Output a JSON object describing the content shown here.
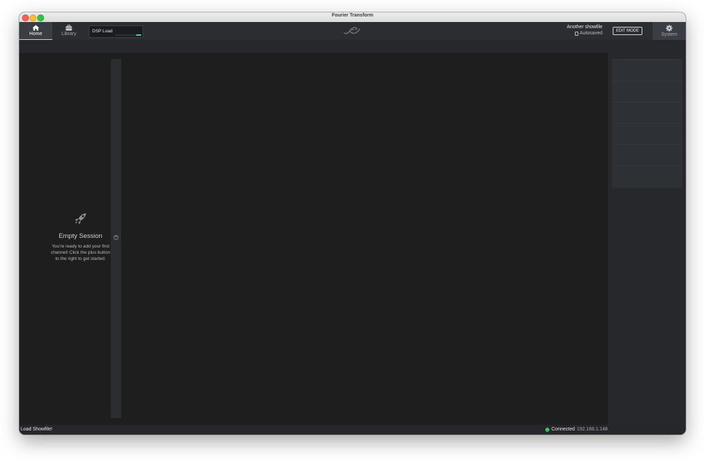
{
  "window": {
    "title": "Fourier Transform"
  },
  "nav": {
    "home": {
      "label": "Home",
      "icon": "home-icon"
    },
    "library": {
      "label": "Library",
      "icon": "briefcase-icon"
    },
    "system": {
      "label": "System",
      "icon": "gear-icon"
    }
  },
  "dsp": {
    "label": "DSP Load",
    "load_fraction": 0.18
  },
  "showfile": {
    "name": "Another showfile",
    "status": "Autosaved"
  },
  "edit_mode": {
    "label": "EDIT MODE"
  },
  "empty_session": {
    "icon": "rocket-icon",
    "title": "Empty Session",
    "description": "You're ready to add your first channel! Click the plus button to the right to get started."
  },
  "add_channel": {
    "icon": "plus-icon",
    "glyph": "+"
  },
  "statusbar": {
    "load_showfile": "Load Showfile!",
    "connection_label": "Connected",
    "ip": "192.168.1.148"
  },
  "colors": {
    "accent": "#49d3c1",
    "connected": "#34c759",
    "background": "#1e1e1e"
  }
}
